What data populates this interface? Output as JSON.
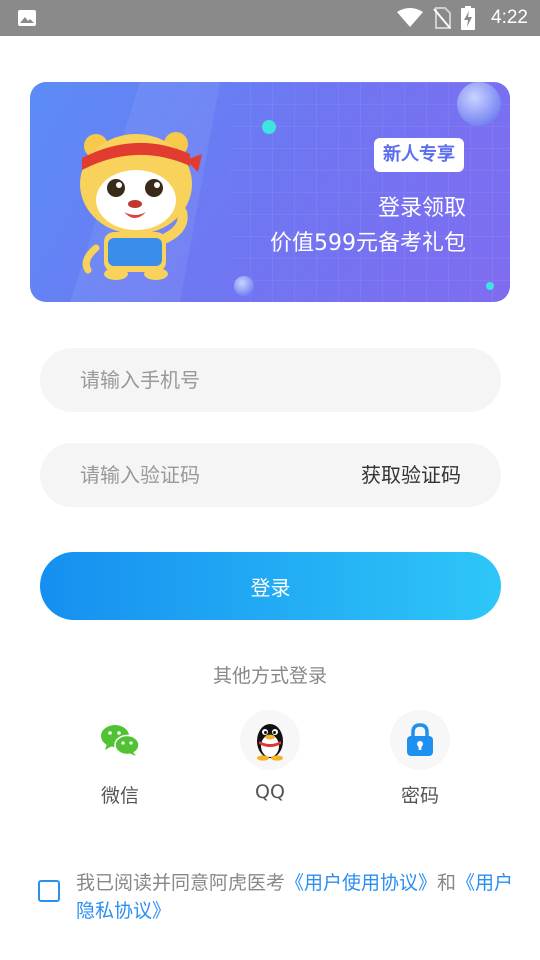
{
  "status_bar": {
    "time": "4:22",
    "icons": [
      "image-icon",
      "wifi-icon",
      "no-sim-icon",
      "battery-charging-icon"
    ]
  },
  "banner": {
    "badge": "新人专享",
    "line1": "登录领取",
    "line2": "价值599元备考礼包",
    "mascot_icon": "tiger-mascot-icon"
  },
  "form": {
    "phone_placeholder": "请输入手机号",
    "code_placeholder": "请输入验证码",
    "get_code_label": "获取验证码",
    "login_label": "登录"
  },
  "other_login": {
    "title": "其他方式登录",
    "methods": [
      {
        "label": "微信",
        "icon": "wechat-icon",
        "color": "#51c332"
      },
      {
        "label": "QQ",
        "icon": "qq-penguin-icon",
        "color": "#000000"
      },
      {
        "label": "密码",
        "icon": "lock-icon",
        "color": "#1e90f0"
      }
    ]
  },
  "agreement": {
    "prefix": "我已阅读并同意阿虎医考",
    "user_agreement": "《用户使用协议》",
    "connector": "和",
    "privacy_agreement": "《用户隐私协议》"
  },
  "colors": {
    "accent": "#1e90f0",
    "banner_start": "#5b8cf7",
    "banner_end": "#7f6cf0",
    "status_bar": "#8a8a8a"
  }
}
